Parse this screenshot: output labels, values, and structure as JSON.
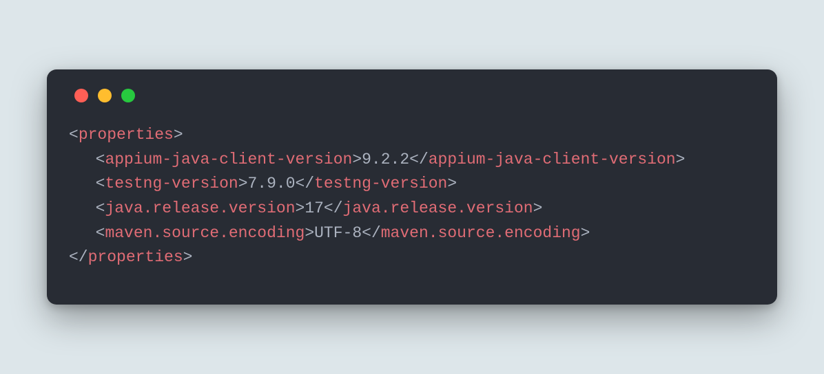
{
  "colors": {
    "background": "#dde6ea",
    "window": "#282c34",
    "trafficRed": "#ff5f56",
    "trafficYellow": "#ffbd2e",
    "trafficGreen": "#27c93f",
    "punct": "#abb2bf",
    "tag": "#e06c75",
    "text": "#abb2bf"
  },
  "code": {
    "root_open": "properties",
    "root_close": "properties",
    "props": [
      {
        "name": "appium-java-client-version",
        "value": "9.2.2"
      },
      {
        "name": "testng-version",
        "value": "7.9.0"
      },
      {
        "name": "java.release.version",
        "value": "17"
      },
      {
        "name": "maven.source.encoding",
        "value": "UTF-8"
      }
    ]
  }
}
